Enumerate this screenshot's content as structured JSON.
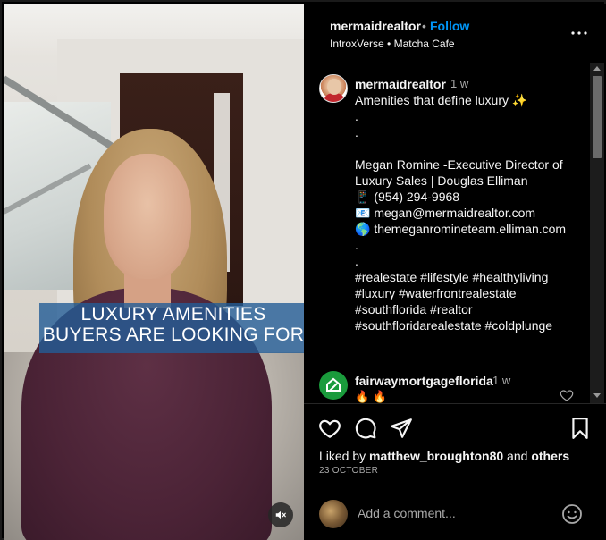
{
  "video": {
    "caption_line1": "LUXURY AMENITIES",
    "caption_line2": "BUYERS ARE LOOKING FOR",
    "mute_icon": "speaker-muted-icon"
  },
  "header": {
    "username": "mermaidrealtor",
    "separator": "•",
    "follow_label": "Follow",
    "subtitle": "IntroxVerse • Matcha Cafe",
    "more_icon": "more-options-icon"
  },
  "caption": {
    "username": "mermaidrealtor",
    "time": "1 w",
    "text": "Amenities that define luxury ✨\n.\n.\n\nMegan Romine -Executive Director of Luxury Sales | Douglas Elliman\n📱 (954) 294-9968\n📧 megan@mermaidrealtor.com\n🌎 themeganromineteam.elliman.com\n.\n.\n#realestate #lifestyle #healthyliving #luxury #waterfrontrealestate #southflorida #realtor #southfloridarealestate #coldplunge"
  },
  "comment": {
    "username": "fairwaymortgageflorida",
    "time": "1 w",
    "text": "🔥 🔥"
  },
  "actions": {
    "liked_by_prefix": "Liked by ",
    "liked_by_user": "matthew_broughton80",
    "liked_by_middle": " and ",
    "liked_by_others": "others",
    "date": "23 OCTOBER"
  },
  "comment_box": {
    "placeholder": "Add a comment..."
  },
  "colors": {
    "background": "#000000",
    "follow": "#0095f6",
    "caption_band": "#235c96",
    "secondary_text": "#a8a8a8"
  }
}
